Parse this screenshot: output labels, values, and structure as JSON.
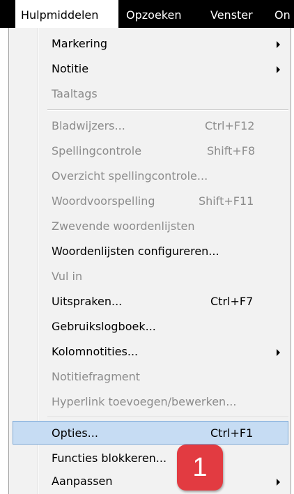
{
  "menubar": {
    "items": [
      "Hulpmiddelen",
      "Opzoeken",
      "Venster",
      "On"
    ]
  },
  "menu": {
    "items": [
      {
        "label": "Markering",
        "shortcut": "",
        "submenu": true,
        "enabled": true
      },
      {
        "label": "Notitie",
        "shortcut": "",
        "submenu": true,
        "enabled": true
      },
      {
        "label": "Taaltags",
        "shortcut": "",
        "submenu": false,
        "enabled": false
      },
      {
        "label": "Bladwijzers...",
        "shortcut": "Ctrl+F12",
        "submenu": false,
        "enabled": false
      },
      {
        "label": "Spellingcontrole",
        "shortcut": "Shift+F8",
        "submenu": false,
        "enabled": false
      },
      {
        "label": "Overzicht spellingcontrole...",
        "shortcut": "",
        "submenu": false,
        "enabled": false
      },
      {
        "label": "Woordvoorspelling",
        "shortcut": "Shift+F11",
        "submenu": false,
        "enabled": false
      },
      {
        "label": "Zwevende woordenlijsten",
        "shortcut": "",
        "submenu": false,
        "enabled": false
      },
      {
        "label": "Woordenlijsten configureren...",
        "shortcut": "",
        "submenu": false,
        "enabled": true
      },
      {
        "label": "Vul in",
        "shortcut": "",
        "submenu": false,
        "enabled": false
      },
      {
        "label": "Uitspraken...",
        "shortcut": "Ctrl+F7",
        "submenu": false,
        "enabled": true
      },
      {
        "label": "Gebruikslogboek...",
        "shortcut": "",
        "submenu": false,
        "enabled": true
      },
      {
        "label": "Kolomnotities...",
        "shortcut": "",
        "submenu": true,
        "enabled": true
      },
      {
        "label": "Notitiefragment",
        "shortcut": "",
        "submenu": false,
        "enabled": false
      },
      {
        "label": "Hyperlink toevoegen/bewerken...",
        "shortcut": "",
        "submenu": false,
        "enabled": false
      },
      {
        "label": "Opties...",
        "shortcut": "Ctrl+F1",
        "submenu": false,
        "enabled": true,
        "highlighted": true
      },
      {
        "label": "Functies blokkeren...",
        "shortcut": "",
        "submenu": false,
        "enabled": true
      },
      {
        "label": "Aanpassen",
        "shortcut": "",
        "submenu": true,
        "enabled": true
      }
    ]
  },
  "callout": {
    "number": "1",
    "color": "#e23b41"
  },
  "colors": {
    "highlight": "#c6dcf3",
    "disabled_text": "#8c8c8c",
    "menubar": "#000000"
  }
}
